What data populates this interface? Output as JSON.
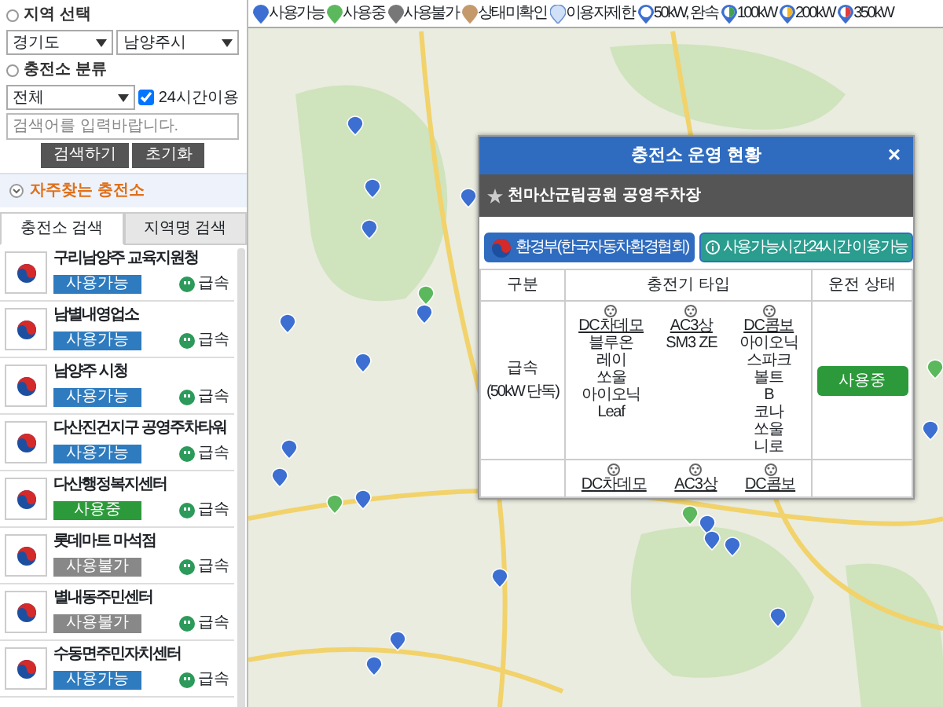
{
  "sidebar": {
    "region": {
      "label": "지역 선택",
      "province": "경기도",
      "city": "남양주시"
    },
    "category": {
      "label": "충전소 분류",
      "value": "전체",
      "checkbox": {
        "label": "24시간이용",
        "checked": true
      }
    },
    "search": {
      "placeholder": "검색어를 입력바랍니다."
    },
    "buttons": [
      "검색하기",
      "초기화"
    ],
    "favorites": {
      "label": "자주찾는 충전소",
      "expanded": false
    },
    "tabs": [
      {
        "label": "충전소 검색",
        "selected": true
      },
      {
        "label": "지역명 검색",
        "selected": false
      }
    ],
    "stations": [
      {
        "name": "구리남양주 교육지원청",
        "status": "사용가능",
        "kind": "available",
        "speed": "급속"
      },
      {
        "name": "남별내영업소",
        "status": "사용가능",
        "kind": "available",
        "speed": "급속"
      },
      {
        "name": "남양주 시청",
        "status": "사용가능",
        "kind": "available",
        "speed": "급속"
      },
      {
        "name": "다산진건지구 공영주차타워",
        "status": "사용가능",
        "kind": "available",
        "speed": "급속"
      },
      {
        "name": "다산행정복지센터",
        "status": "사용중",
        "kind": "in_use",
        "speed": "급속"
      },
      {
        "name": "롯데마트 마석점",
        "status": "사용불가",
        "kind": "unavailable",
        "speed": "급속"
      },
      {
        "name": "별내동주민센터",
        "status": "사용불가",
        "kind": "unavailable",
        "speed": "급속"
      },
      {
        "name": "수동면주민자치센터",
        "status": "사용가능",
        "kind": "available",
        "speed": "급속"
      }
    ]
  },
  "legend": [
    {
      "label": "사용가능",
      "kind": "status",
      "color": "#3c6fd1"
    },
    {
      "label": "사용중",
      "kind": "status",
      "color": "#5cb85c"
    },
    {
      "label": "사용불가",
      "kind": "status",
      "color": "#777777"
    },
    {
      "label": "상태미확인",
      "kind": "status",
      "color": "#c49a6c"
    },
    {
      "label": "이용자제한",
      "kind": "restricted",
      "color": "#cfe0f7"
    },
    {
      "label": "50kW, 완속",
      "kind": "capacity",
      "color": "#ffffff"
    },
    {
      "label": "100kW",
      "kind": "capacity",
      "color": "#3fa34d"
    },
    {
      "label": "200kW",
      "kind": "capacity",
      "color": "#f0b429"
    },
    {
      "label": "350kW",
      "kind": "capacity",
      "color": "#e03c3c"
    }
  ],
  "popup": {
    "title": "충전소 운영 현황",
    "close": "×",
    "station": "천마산군립공원 공영주차장",
    "operator": "환경부(한국자동차환경협회)",
    "hours": "사용가능시간:24시간 이용가능",
    "columns": [
      "구분",
      "충전기 타입",
      "운전 상태"
    ],
    "rows": [
      {
        "type": "급속",
        "detail": "(50kW 단독)",
        "status": "사용중",
        "kind": "in_use",
        "chargers": [
          {
            "name": "DC차데모",
            "cars": [
              "블루온",
              "레이",
              "쏘울",
              "아이오닉",
              "Leaf"
            ]
          },
          {
            "name": "AC3상",
            "cars": [
              "SM3 ZE"
            ]
          },
          {
            "name": "DC콤보",
            "cars": [
              "아이오닉",
              "스파크",
              "볼트",
              "B",
              "코나",
              "쏘울",
              "니로"
            ]
          }
        ]
      },
      {
        "chargers": [
          {
            "name": "DC차데모"
          },
          {
            "name": "AC3상"
          },
          {
            "name": "DC콤보"
          }
        ]
      }
    ]
  }
}
